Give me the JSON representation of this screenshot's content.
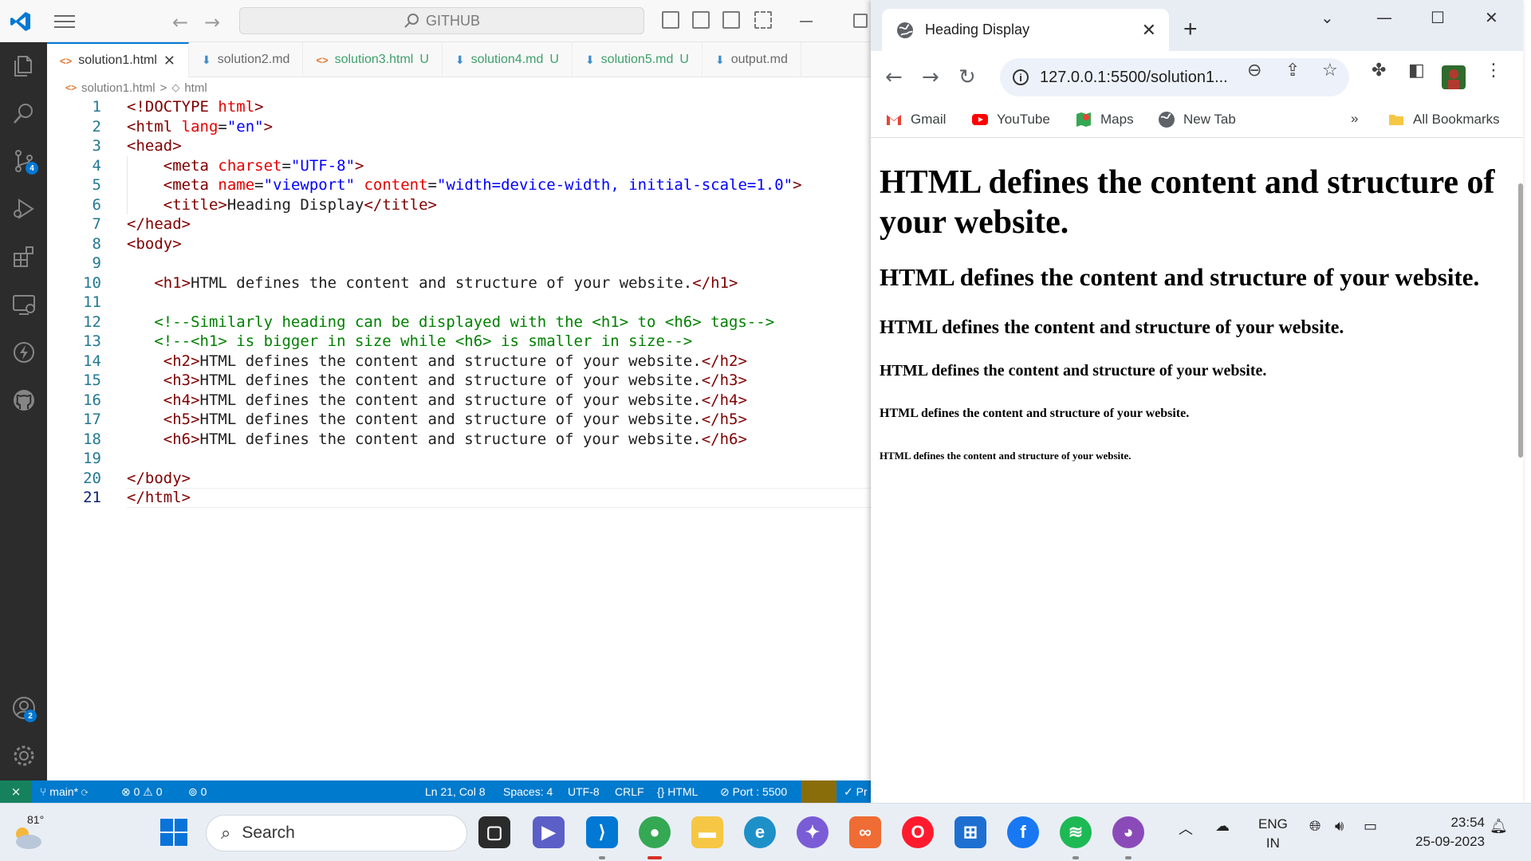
{
  "vscode": {
    "search_text": "GITHUB",
    "tabs": [
      {
        "name": "solution1.html",
        "status": "",
        "active": true,
        "kind": "html"
      },
      {
        "name": "solution2.md",
        "status": "",
        "active": false,
        "kind": "md"
      },
      {
        "name": "solution3.html",
        "status": "U",
        "active": false,
        "kind": "html"
      },
      {
        "name": "solution4.md",
        "status": "U",
        "active": false,
        "kind": "md"
      },
      {
        "name": "solution5.md",
        "status": "U",
        "active": false,
        "kind": "md"
      },
      {
        "name": "output.md",
        "status": "",
        "active": false,
        "kind": "md"
      }
    ],
    "breadcrumb": {
      "file": "solution1.html",
      "separator": ">",
      "node": "html"
    },
    "code_lines": [
      {
        "n": "1",
        "tokens": [
          [
            "t-tag",
            "<!DOCTYPE "
          ],
          [
            "t-attr",
            "html"
          ],
          [
            "t-tag",
            ">"
          ]
        ]
      },
      {
        "n": "2",
        "tokens": [
          [
            "t-tag",
            "<html "
          ],
          [
            "t-attr",
            "lang"
          ],
          [
            "t-plain",
            "="
          ],
          [
            "t-str",
            "\"en\""
          ],
          [
            "t-tag",
            ">"
          ]
        ]
      },
      {
        "n": "3",
        "tokens": [
          [
            "t-tag",
            "<head>"
          ]
        ]
      },
      {
        "n": "4",
        "tokens": [
          [
            "t-plain",
            "    "
          ],
          [
            "t-tag",
            "<meta "
          ],
          [
            "t-attr",
            "charset"
          ],
          [
            "t-plain",
            "="
          ],
          [
            "t-str",
            "\"UTF-8\""
          ],
          [
            "t-tag",
            ">"
          ]
        ]
      },
      {
        "n": "5",
        "tokens": [
          [
            "t-plain",
            "    "
          ],
          [
            "t-tag",
            "<meta "
          ],
          [
            "t-attr",
            "name"
          ],
          [
            "t-plain",
            "="
          ],
          [
            "t-str",
            "\"viewport\""
          ],
          [
            "t-plain",
            " "
          ],
          [
            "t-attr",
            "content"
          ],
          [
            "t-plain",
            "="
          ],
          [
            "t-str",
            "\"width=device-width, initial-scale=1.0\""
          ],
          [
            "t-tag",
            ">"
          ]
        ]
      },
      {
        "n": "6",
        "tokens": [
          [
            "t-plain",
            "    "
          ],
          [
            "t-tag",
            "<title>"
          ],
          [
            "t-plain",
            "Heading Display"
          ],
          [
            "t-tag",
            "</title>"
          ]
        ]
      },
      {
        "n": "7",
        "tokens": [
          [
            "t-tag",
            "</head>"
          ]
        ]
      },
      {
        "n": "8",
        "tokens": [
          [
            "t-tag",
            "<body>"
          ]
        ]
      },
      {
        "n": "9",
        "tokens": []
      },
      {
        "n": "10",
        "tokens": [
          [
            "t-plain",
            "   "
          ],
          [
            "t-tag",
            "<h1>"
          ],
          [
            "t-plain",
            "HTML defines the content and structure of your website."
          ],
          [
            "t-tag",
            "</h1>"
          ]
        ]
      },
      {
        "n": "11",
        "tokens": []
      },
      {
        "n": "12",
        "tokens": [
          [
            "t-plain",
            "   "
          ],
          [
            "t-cmt",
            "<!--Similarly heading can be displayed with the <h1> to <h6> tags-->"
          ]
        ]
      },
      {
        "n": "13",
        "tokens": [
          [
            "t-plain",
            "   "
          ],
          [
            "t-cmt",
            "<!--<h1> is bigger in size while <h6> is smaller in size-->"
          ]
        ]
      },
      {
        "n": "14",
        "tokens": [
          [
            "t-plain",
            "    "
          ],
          [
            "t-tag",
            "<h2>"
          ],
          [
            "t-plain",
            "HTML defines the content and structure of your website."
          ],
          [
            "t-tag",
            "</h2>"
          ]
        ]
      },
      {
        "n": "15",
        "tokens": [
          [
            "t-plain",
            "    "
          ],
          [
            "t-tag",
            "<h3>"
          ],
          [
            "t-plain",
            "HTML defines the content and structure of your website."
          ],
          [
            "t-tag",
            "</h3>"
          ]
        ]
      },
      {
        "n": "16",
        "tokens": [
          [
            "t-plain",
            "    "
          ],
          [
            "t-tag",
            "<h4>"
          ],
          [
            "t-plain",
            "HTML defines the content and structure of your website."
          ],
          [
            "t-tag",
            "</h4>"
          ]
        ]
      },
      {
        "n": "17",
        "tokens": [
          [
            "t-plain",
            "    "
          ],
          [
            "t-tag",
            "<h5>"
          ],
          [
            "t-plain",
            "HTML defines the content and structure of your website."
          ],
          [
            "t-tag",
            "</h5>"
          ]
        ]
      },
      {
        "n": "18",
        "tokens": [
          [
            "t-plain",
            "    "
          ],
          [
            "t-tag",
            "<h6>"
          ],
          [
            "t-plain",
            "HTML defines the content and structure of your website."
          ],
          [
            "t-tag",
            "</h6>"
          ]
        ]
      },
      {
        "n": "19",
        "tokens": []
      },
      {
        "n": "20",
        "tokens": [
          [
            "t-tag",
            "</body>"
          ]
        ]
      },
      {
        "n": "21",
        "tokens": [
          [
            "t-tag",
            "</html>"
          ]
        ]
      }
    ],
    "current_line": "21",
    "badges": {
      "source_control": "4",
      "accounts": "2"
    },
    "status": {
      "branch": "main*",
      "errors": "0",
      "warnings": "0",
      "ports": "0",
      "position": "Ln 21, Col 8",
      "spaces": "Spaces: 4",
      "encoding": "UTF-8",
      "eol": "CRLF",
      "language": "HTML",
      "port": "Port : 5500",
      "prettier": "Pr"
    }
  },
  "chrome": {
    "tab_title": "Heading Display",
    "url": "127.0.0.1:5500/solution1...",
    "bookmarks": [
      "Gmail",
      "YouTube",
      "Maps",
      "New Tab"
    ],
    "overflow": "»",
    "all_bookmarks": "All Bookmarks",
    "page": {
      "h1": "HTML defines the content and structure of your website.",
      "h2": "HTML defines the content and structure of your website.",
      "h3": "HTML defines the content and structure of your website.",
      "h4": "HTML defines the content and structure of your website.",
      "h5": "HTML defines the content and structure of your website.",
      "h6": "HTML defines the content and structure of your website."
    }
  },
  "taskbar": {
    "temperature": "81°",
    "search_placeholder": "Search",
    "language_line1": "ENG",
    "language_line2": "IN",
    "time": "23:54",
    "date": "25-09-2023"
  },
  "colors": {
    "accent": "#0078d4",
    "statusbar": "#007acc",
    "remote": "#16825d"
  }
}
